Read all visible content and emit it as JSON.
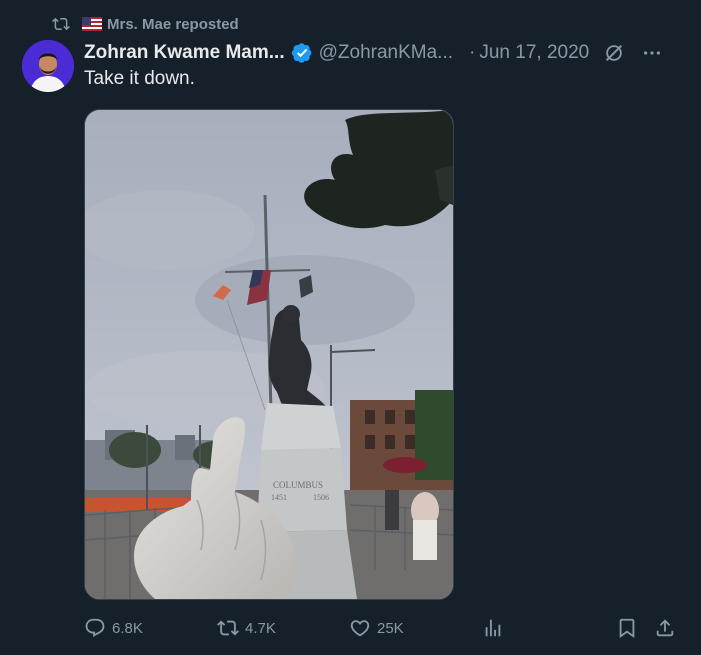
{
  "repost": {
    "label": "Mrs. Mae reposted",
    "icon": "repost-icon",
    "flag": "us-flag-icon"
  },
  "author": {
    "name": "Zohran Kwame Mam...",
    "handle": "@ZohranKMa...",
    "verified": true,
    "date": "Jun 17, 2020",
    "separator": "·"
  },
  "tweet": {
    "text": "Take it down."
  },
  "media": {
    "pedestal_text": "COLUMBUS",
    "year_left": "1451",
    "year_right": "1506"
  },
  "actions": {
    "replies": "6.8K",
    "reposts": "4.7K",
    "likes": "25K"
  },
  "colors": {
    "background": "#15202b",
    "text": "#e7e9ea",
    "muted": "#8b98a5",
    "verified": "#1d9bf0",
    "avatar_bg": "#4a2bd6"
  }
}
